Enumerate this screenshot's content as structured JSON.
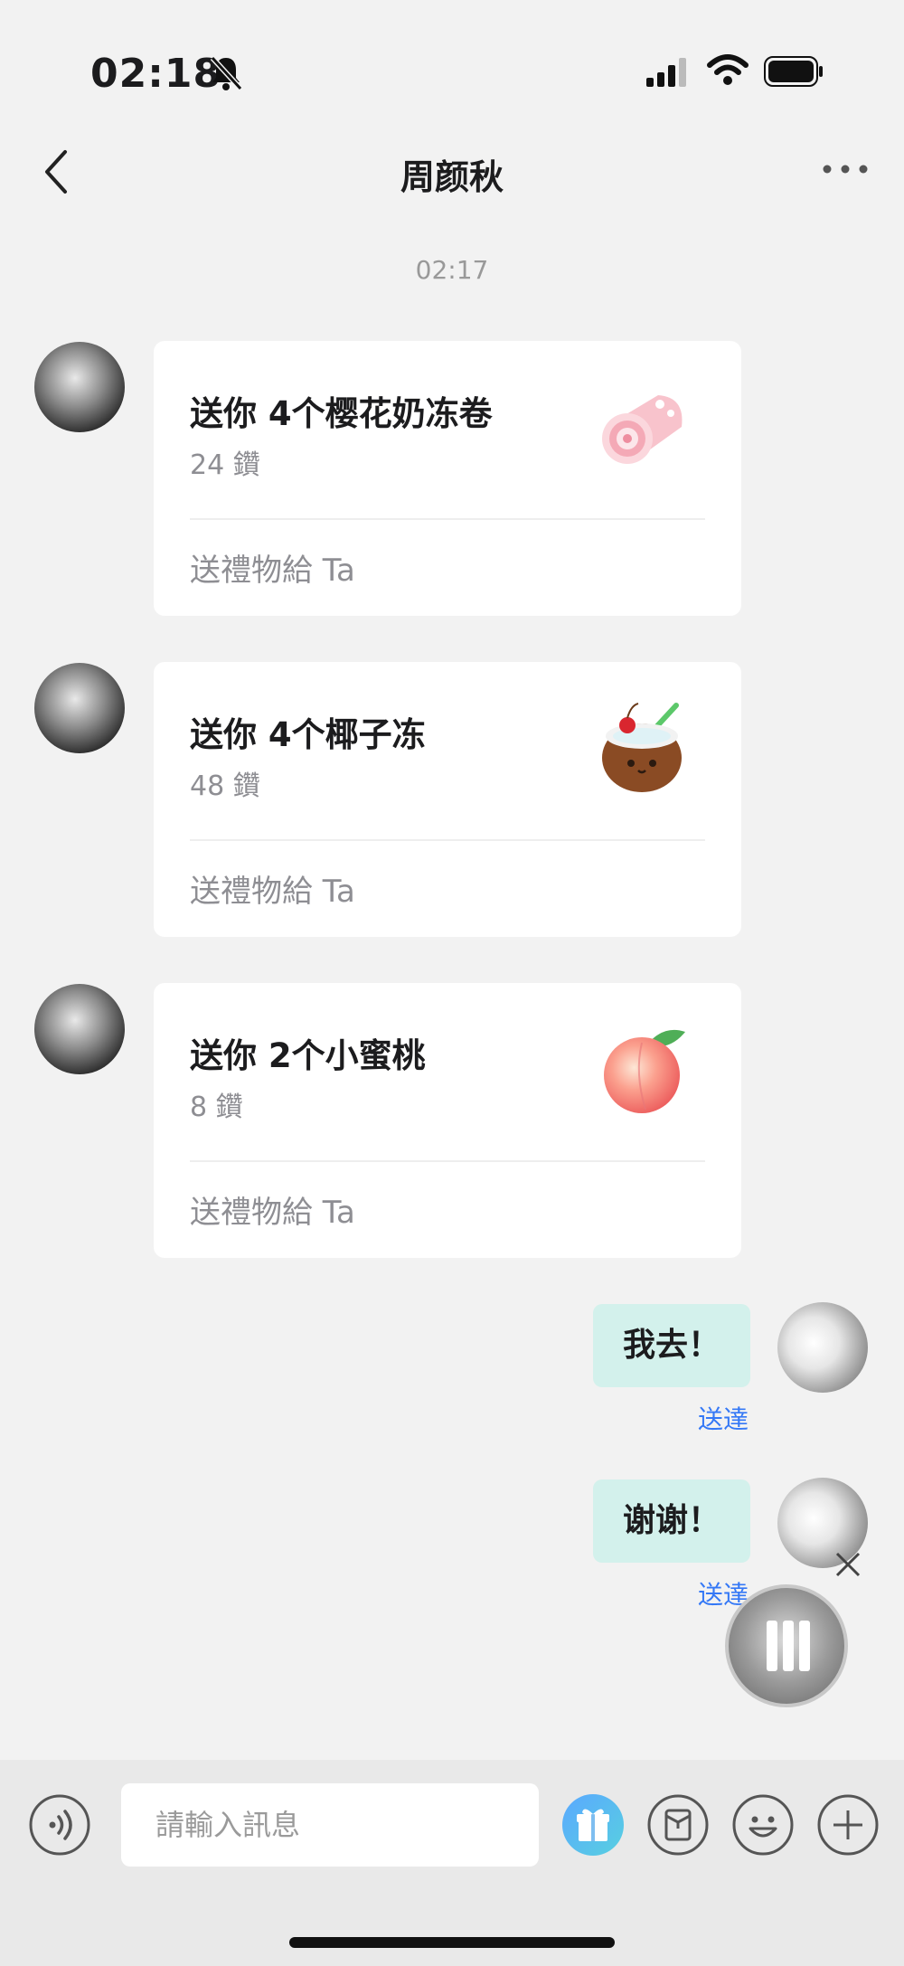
{
  "status_bar": {
    "time": "02:18"
  },
  "header": {
    "title": "周颜秋"
  },
  "timestamp": "02:17",
  "gift_cards": [
    {
      "title": "送你 4个樱花奶冻卷",
      "price": "24 鑽",
      "action": "送禮物給 Ta"
    },
    {
      "title": "送你 4个椰子冻",
      "price": "48 鑽",
      "action": "送禮物給 Ta"
    },
    {
      "title": "送你 2个小蜜桃",
      "price": "8 鑽",
      "action": "送禮物給 Ta"
    }
  ],
  "sent_messages": [
    {
      "text": "我去！",
      "status": "送達"
    },
    {
      "text": "谢谢！",
      "status": "送達"
    }
  ],
  "input": {
    "placeholder": "請輸入訊息"
  },
  "colors": {
    "bubble": "#d3f1ec",
    "delivered": "#3478f6",
    "gift_button": "#5aa8ff"
  }
}
